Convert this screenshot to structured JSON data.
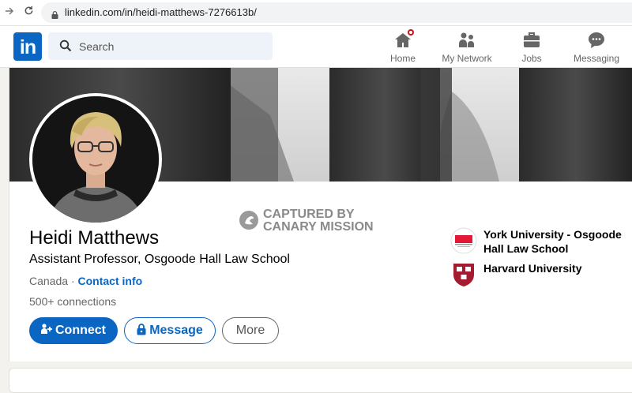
{
  "browser": {
    "url": "linkedin.com/in/heidi-matthews-7276613b/"
  },
  "header": {
    "logo_text": "in",
    "search_placeholder": "Search",
    "nav": [
      {
        "label": "Home",
        "icon": "home-icon"
      },
      {
        "label": "My Network",
        "icon": "people-icon"
      },
      {
        "label": "Jobs",
        "icon": "briefcase-icon"
      },
      {
        "label": "Messaging",
        "icon": "chat-icon"
      }
    ]
  },
  "watermark": {
    "line1": "CAPTURED BY",
    "line2": "CANARY MISSION"
  },
  "profile": {
    "name": "Heidi Matthews",
    "headline": "Assistant Professor, Osgoode Hall Law School",
    "location": "Canada",
    "separator": "·",
    "contact_info": "Contact info",
    "connections": "500+ connections",
    "buttons": {
      "connect": "Connect",
      "message": "Message",
      "more": "More"
    }
  },
  "education": [
    {
      "name": "York University - Osgoode Hall Law School"
    },
    {
      "name": "Harvard University"
    }
  ],
  "colors": {
    "brand": "#0a66c2",
    "notification": "#cc1016"
  }
}
